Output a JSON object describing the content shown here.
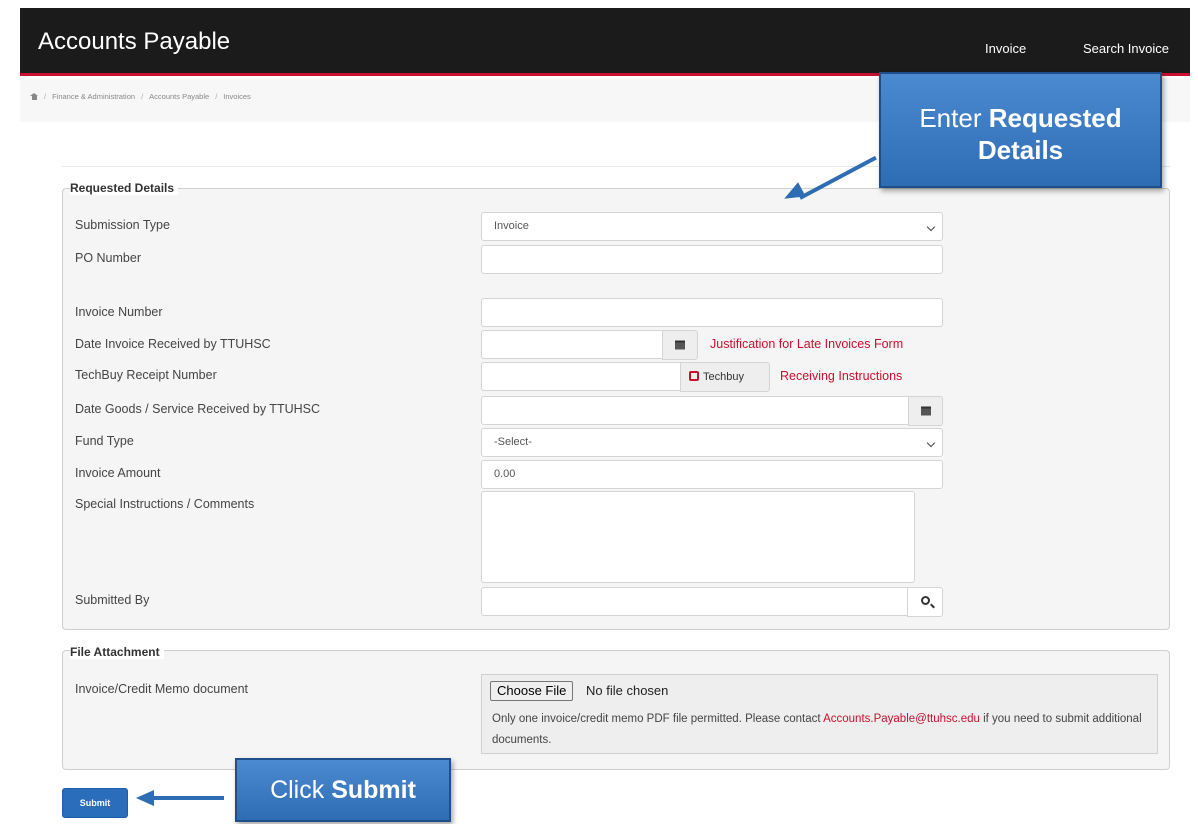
{
  "header": {
    "brand": "Accounts Payable",
    "nav": [
      "Invoice",
      "Search Invoice"
    ]
  },
  "breadcrumb": [
    "Finance & Administration",
    "Accounts Payable",
    "Invoices"
  ],
  "requested_details": {
    "legend": "Requested Details",
    "submission_type": {
      "label": "Submission Type",
      "value": "Invoice"
    },
    "po_number": {
      "label": "PO Number",
      "value": ""
    },
    "invoice_number": {
      "label": "Invoice Number",
      "value": ""
    },
    "date_invoice_received": {
      "label": "Date Invoice Received by TTUHSC",
      "value": "",
      "link": "Justification for Late Invoices Form"
    },
    "techbuy_receipt": {
      "label": "TechBuy Receipt Number",
      "value": "",
      "button": "Techbuy",
      "link": "Receiving Instructions"
    },
    "date_goods_received": {
      "label": "Date Goods / Service Received by TTUHSC",
      "value": ""
    },
    "fund_type": {
      "label": "Fund Type",
      "value": "-Select-"
    },
    "invoice_amount": {
      "label": "Invoice Amount",
      "value": "0.00"
    },
    "special_instructions": {
      "label": "Special Instructions / Comments",
      "value": ""
    },
    "submitted_by": {
      "label": "Submitted By",
      "value": ""
    }
  },
  "file_attachment": {
    "legend": "File Attachment",
    "label": "Invoice/Credit Memo document",
    "choose_button": "Choose File",
    "no_file": "No file chosen",
    "note_before": "Only one invoice/credit memo PDF file permitted. Please contact ",
    "email": "Accounts.Payable@ttuhsc.edu",
    "note_after": " if you need to submit additional documents."
  },
  "submit_label": "Submit",
  "callouts": {
    "top_normal": "Enter ",
    "top_bold": "Requested Details",
    "bottom_normal": "Click ",
    "bottom_bold": "Submit"
  },
  "colors": {
    "header_bg": "#1b1b1b",
    "accent_red": "#c8102e",
    "primary_blue": "#2a6ebb",
    "callout_blue": "#3a7bc5"
  }
}
